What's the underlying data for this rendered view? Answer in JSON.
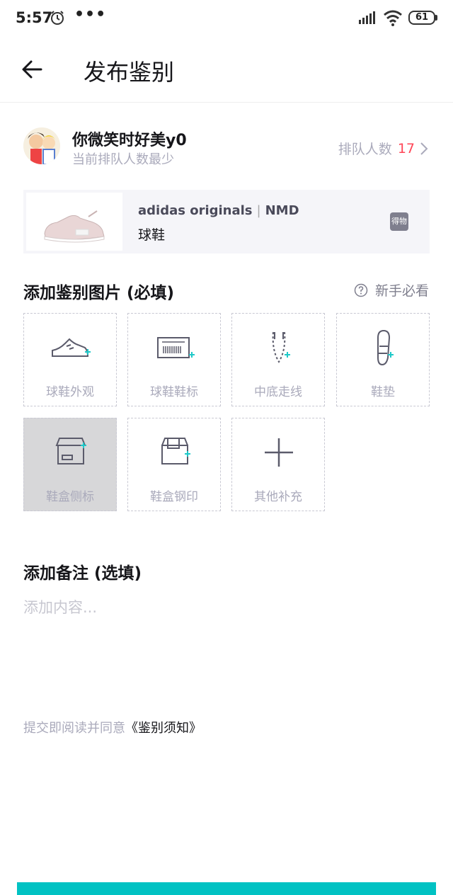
{
  "status_bar": {
    "time": "5:57",
    "dots": "•••",
    "battery": "61"
  },
  "header": {
    "title": "发布鉴别"
  },
  "user": {
    "name": "你微笑时好美y0",
    "note": "当前排队人数最少",
    "queue_label": "排队人数",
    "queue_count": "17"
  },
  "product": {
    "brand": "adidas originals",
    "model": "NMD",
    "category": "球鞋",
    "badge": "得物"
  },
  "photos_section": {
    "title": "添加鉴别图片 (必填)",
    "help": "新手必看",
    "tiles": [
      {
        "label": "球鞋外观",
        "icon": "shoe-exterior-icon"
      },
      {
        "label": "球鞋鞋标",
        "icon": "shoe-label-icon"
      },
      {
        "label": "中底走线",
        "icon": "midsole-stitch-icon"
      },
      {
        "label": "鞋垫",
        "icon": "insole-icon"
      },
      {
        "label": "鞋盒侧标",
        "icon": "box-side-label-icon"
      },
      {
        "label": "鞋盒钢印",
        "icon": "box-stamp-icon"
      },
      {
        "label": "其他补充",
        "icon": "plus-icon"
      }
    ]
  },
  "remarks_section": {
    "title": "添加备注 (选填)",
    "placeholder": "添加内容..."
  },
  "agreement": {
    "prefix": "提交即阅读并同意",
    "link": "《鉴别须知》"
  },
  "colors": {
    "accent": "#01c2c3",
    "queue_count": "#ff4657",
    "muted_text": "#aaaabb",
    "tile_plus": "#1ec8c8"
  }
}
